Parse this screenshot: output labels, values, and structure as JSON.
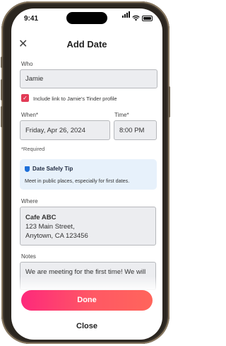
{
  "status_bar": {
    "time": "9:41"
  },
  "header": {
    "title": "Add Date"
  },
  "who": {
    "label": "Who",
    "value": "Jamie"
  },
  "include_link": {
    "checked": true,
    "label": "Include link to Jamie's Tinder profile"
  },
  "when": {
    "label": "When*",
    "value": "Friday, Apr 26, 2024"
  },
  "time_field": {
    "label": "Time*",
    "value": "8:00 PM"
  },
  "required_note": "*Required",
  "tip": {
    "title": "Date Safely Tip",
    "body": "Meet in public places, especially for first dates."
  },
  "where": {
    "label": "Where",
    "name": "Cafe ABC",
    "street": "123 Main Street,",
    "city": "Anytown, CA 123456"
  },
  "notes": {
    "label": "Notes",
    "value": "We are meeting for the first time! We will"
  },
  "actions": {
    "done": "Done",
    "close": "Close"
  },
  "colors": {
    "accent": "#e23b56",
    "tip_bg": "#e7f1fb",
    "tip_icon": "#1e6fd9"
  }
}
